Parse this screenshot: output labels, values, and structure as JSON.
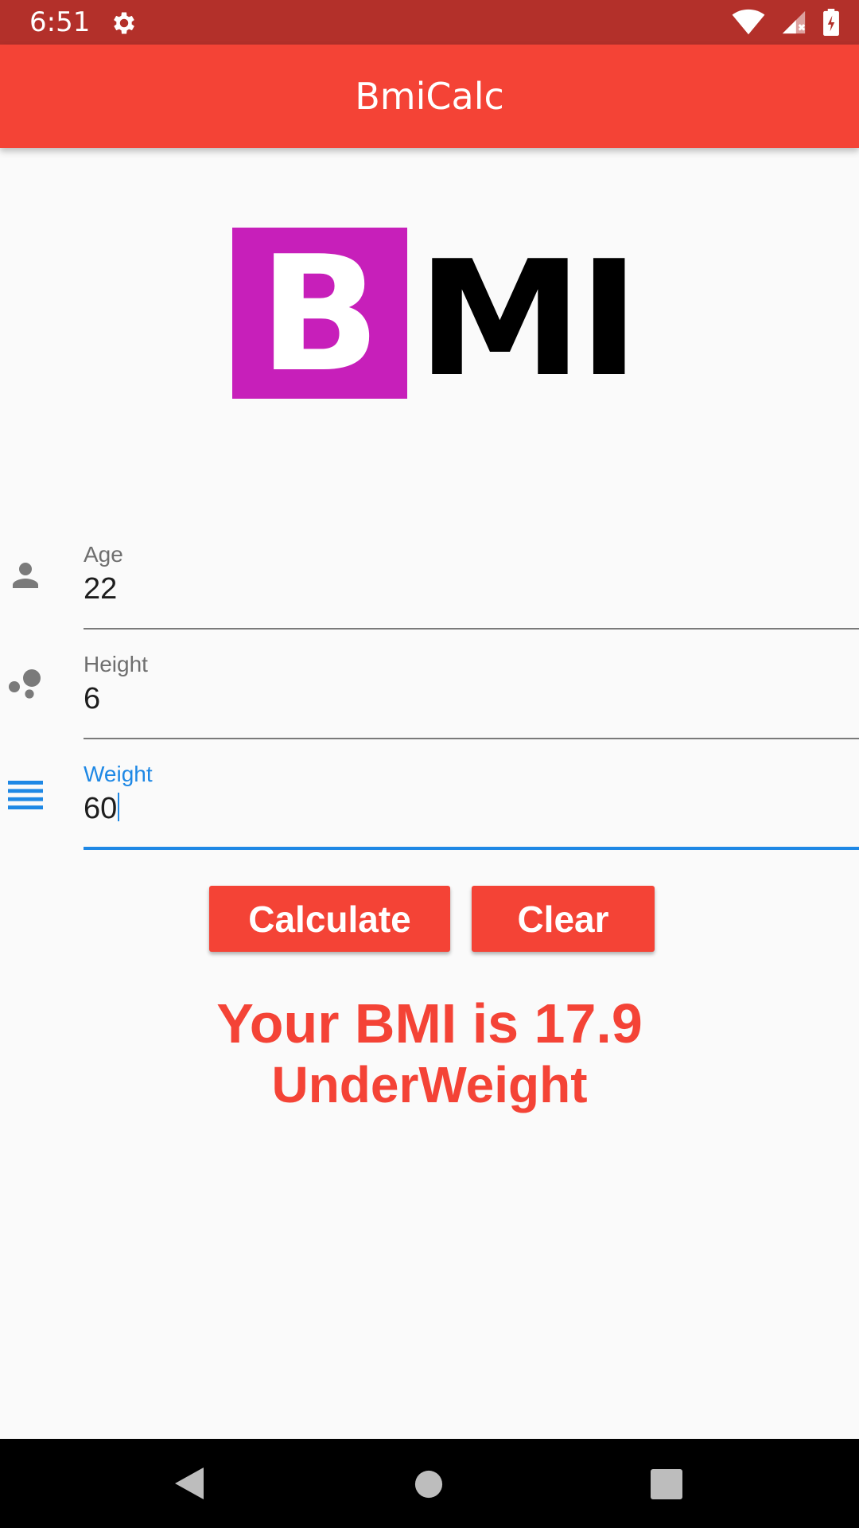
{
  "status_bar": {
    "time": "6:51",
    "icons": [
      "gear-icon",
      "wifi-icon",
      "signal-icon",
      "battery-icon"
    ]
  },
  "app_bar": {
    "title": "BmiCalc"
  },
  "logo": {
    "b": "B",
    "mi": "MI"
  },
  "form": {
    "age": {
      "label": "Age",
      "value": "22",
      "icon": "person-icon"
    },
    "height": {
      "label": "Height",
      "value": "6",
      "icon": "bubbles-icon"
    },
    "weight": {
      "label": "Weight",
      "value": "60",
      "icon": "lines-icon"
    }
  },
  "buttons": {
    "calculate": "Calculate",
    "clear": "Clear"
  },
  "result": {
    "line1": "Your BMI is 17.9",
    "line2": "UnderWeight"
  },
  "nav_bar": {
    "icons": [
      "back-icon",
      "home-icon",
      "recents-icon"
    ]
  },
  "colors": {
    "primary": "#f44336",
    "status_bar": "#b3302a",
    "focus": "#1e88e5",
    "logo_magenta": "#c71fba"
  }
}
